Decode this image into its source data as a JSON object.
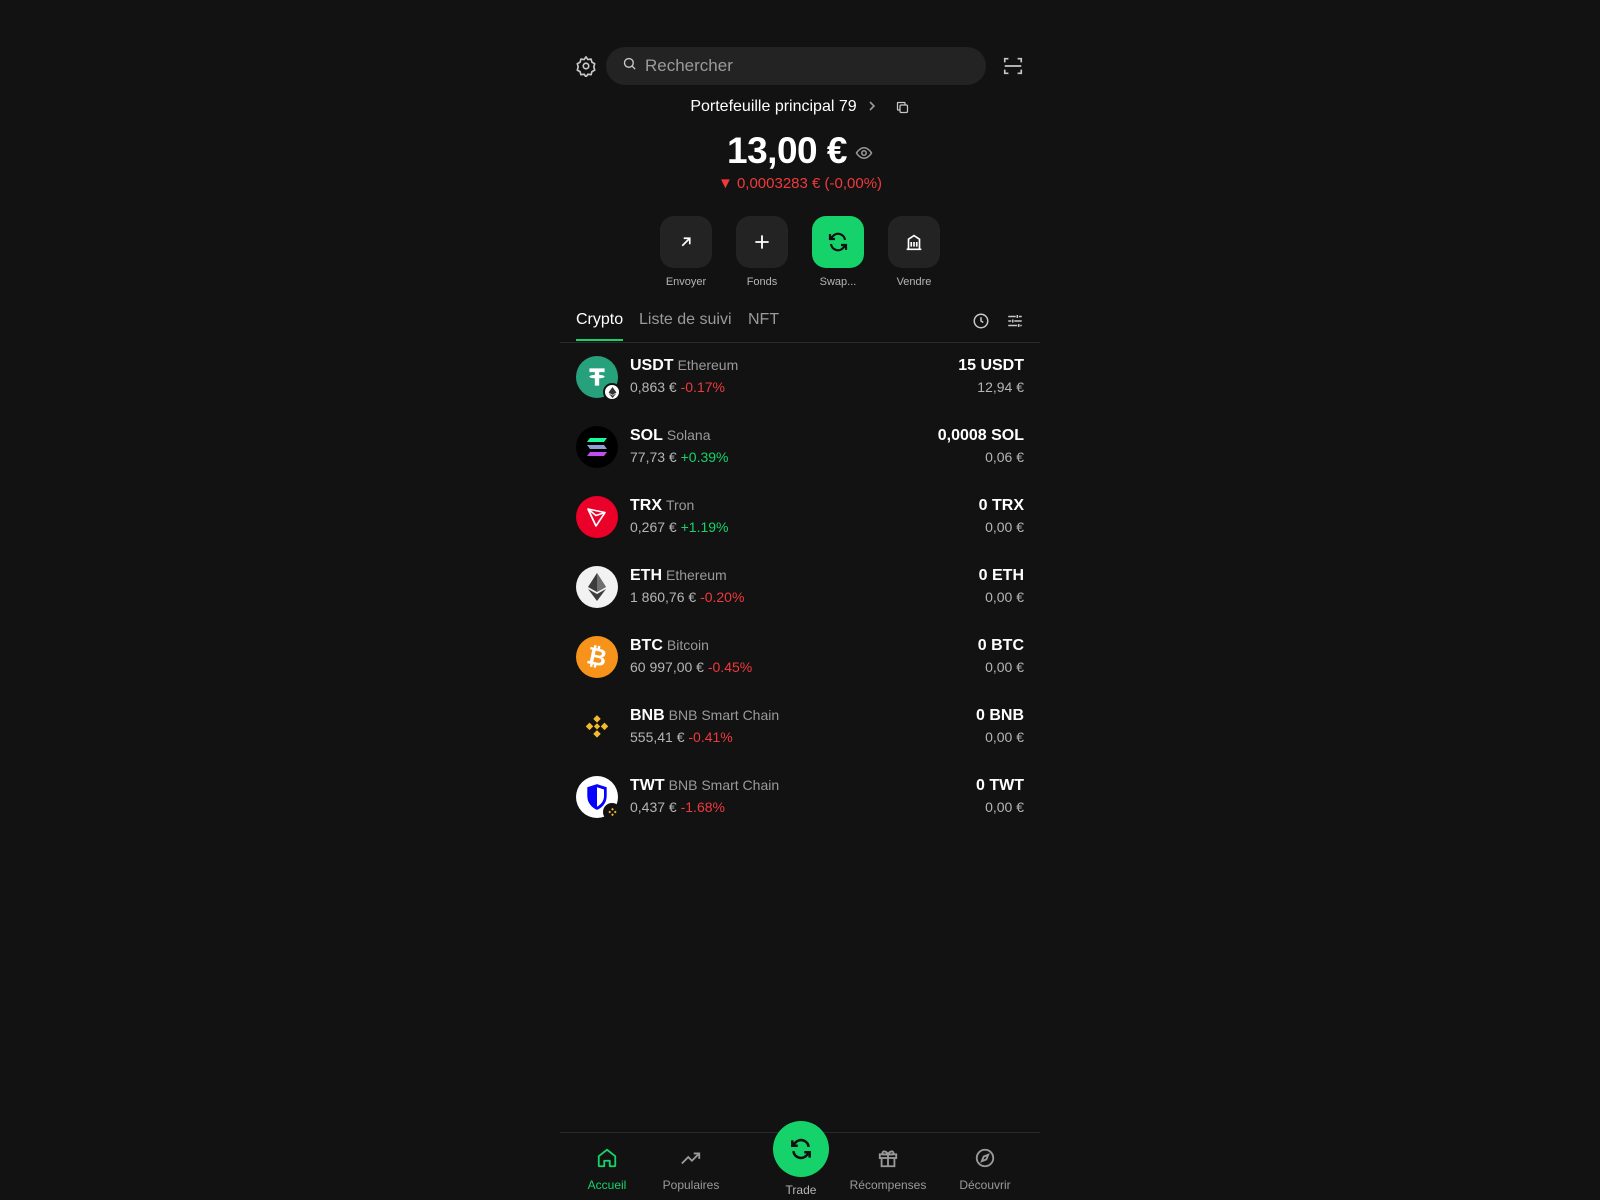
{
  "search": {
    "placeholder": "Rechercher"
  },
  "wallet": {
    "name": "Portefeuille principal 79"
  },
  "balance": {
    "value": "13,00 €",
    "change": "▼ 0,0003283 € (-0,00%)"
  },
  "actions": [
    {
      "label": "Envoyer",
      "icon": "arrow-up-right-icon"
    },
    {
      "label": "Fonds",
      "icon": "plus-icon"
    },
    {
      "label": "Swap...",
      "icon": "swap-icon"
    },
    {
      "label": "Vendre",
      "icon": "bank-icon"
    }
  ],
  "tabs": [
    {
      "label": "Crypto",
      "active": true
    },
    {
      "label": "Liste de suivi",
      "active": false
    },
    {
      "label": "NFT",
      "active": false
    }
  ],
  "assets": [
    {
      "symbol": "USDT",
      "network": "Ethereum",
      "price": "0,863 €",
      "change": "-0.17%",
      "trend": "neg",
      "amount": "15 USDT",
      "fiat": "12,94 €",
      "color": "#26a17b"
    },
    {
      "symbol": "SOL",
      "network": "Solana",
      "price": "77,73 €",
      "change": "+0.39%",
      "trend": "pos",
      "amount": "0,0008 SOL",
      "fiat": "0,06 €",
      "color": "#000000"
    },
    {
      "symbol": "TRX",
      "network": "Tron",
      "price": "0,267 €",
      "change": "+1.19%",
      "trend": "pos",
      "amount": "0 TRX",
      "fiat": "0,00 €",
      "color": "#eb0029"
    },
    {
      "symbol": "ETH",
      "network": "Ethereum",
      "price": "1 860,76 €",
      "change": "-0.20%",
      "trend": "neg",
      "amount": "0 ETH",
      "fiat": "0,00 €",
      "color": "#f2f2f2"
    },
    {
      "symbol": "BTC",
      "network": "Bitcoin",
      "price": "60 997,00 €",
      "change": "-0.45%",
      "trend": "neg",
      "amount": "0 BTC",
      "fiat": "0,00 €",
      "color": "#f7931a"
    },
    {
      "symbol": "BNB",
      "network": "BNB Smart Chain",
      "price": "555,41 €",
      "change": "-0.41%",
      "trend": "neg",
      "amount": "0 BNB",
      "fiat": "0,00 €",
      "color": "#f3ba2f"
    },
    {
      "symbol": "TWT",
      "network": "BNB Smart Chain",
      "price": "0,437 €",
      "change": "-1.68%",
      "trend": "neg",
      "amount": "0 TWT",
      "fiat": "0,00 €",
      "color": "#0500ff"
    }
  ],
  "nav": {
    "home": "Accueil",
    "popular": "Populaires",
    "trade": "Trade",
    "rewards": "Récompenses",
    "discover": "Découvrir"
  },
  "colors": {
    "accent": "#15d36a",
    "negative": "#f0393c",
    "background": "#121212"
  }
}
